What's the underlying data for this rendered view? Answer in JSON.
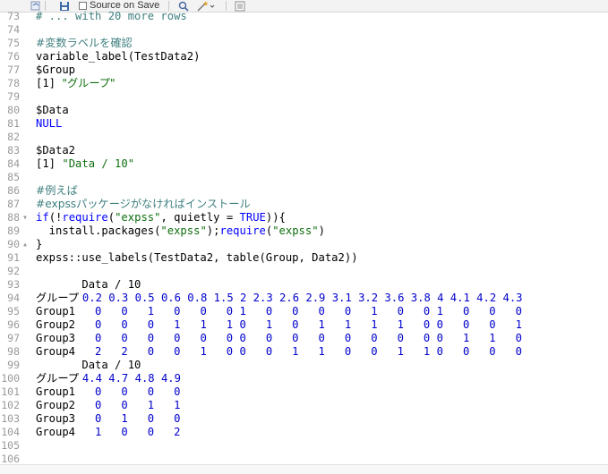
{
  "toolbar": {
    "source_on_save_label": "Source on Save"
  },
  "editor_lines": [
    {
      "n": "73",
      "fold": "",
      "segments": [
        {
          "t": "# ... with 20 more rows",
          "c": "c-comment"
        }
      ]
    },
    {
      "n": "74",
      "fold": "",
      "segments": []
    },
    {
      "n": "75",
      "fold": "",
      "segments": [
        {
          "t": "#変数ラベルを確認",
          "c": "c-comment c-jp"
        }
      ]
    },
    {
      "n": "76",
      "fold": "",
      "segments": [
        {
          "t": "variable_label(TestData2)",
          "c": "c-plain"
        }
      ]
    },
    {
      "n": "77",
      "fold": "",
      "segments": [
        {
          "t": "$Group",
          "c": "c-plain"
        }
      ]
    },
    {
      "n": "78",
      "fold": "",
      "segments": [
        {
          "t": "[1] ",
          "c": "c-plain"
        },
        {
          "t": "\"グループ\"",
          "c": "c-string c-jp"
        }
      ]
    },
    {
      "n": "79",
      "fold": "",
      "segments": []
    },
    {
      "n": "80",
      "fold": "",
      "segments": [
        {
          "t": "$Data",
          "c": "c-plain"
        }
      ]
    },
    {
      "n": "81",
      "fold": "",
      "segments": [
        {
          "t": "NULL",
          "c": "c-kw"
        }
      ]
    },
    {
      "n": "82",
      "fold": "",
      "segments": []
    },
    {
      "n": "83",
      "fold": "",
      "segments": [
        {
          "t": "$Data2",
          "c": "c-plain"
        }
      ]
    },
    {
      "n": "84",
      "fold": "",
      "segments": [
        {
          "t": "[1] ",
          "c": "c-plain"
        },
        {
          "t": "\"Data / 10\"",
          "c": "c-string"
        }
      ]
    },
    {
      "n": "85",
      "fold": "",
      "segments": []
    },
    {
      "n": "86",
      "fold": "",
      "segments": [
        {
          "t": "#例えば",
          "c": "c-comment c-jp"
        }
      ]
    },
    {
      "n": "87",
      "fold": "",
      "segments": [
        {
          "t": "#expssパッケージがなければインストール",
          "c": "c-comment c-jp"
        }
      ]
    },
    {
      "n": "88",
      "fold": "▾",
      "segments": [
        {
          "t": "if",
          "c": "c-kw"
        },
        {
          "t": "(!",
          "c": "c-plain"
        },
        {
          "t": "require",
          "c": "c-kw"
        },
        {
          "t": "(",
          "c": "c-plain"
        },
        {
          "t": "\"expss\"",
          "c": "c-string"
        },
        {
          "t": ", quietly = ",
          "c": "c-plain"
        },
        {
          "t": "TRUE",
          "c": "c-kw"
        },
        {
          "t": ")){",
          "c": "c-plain"
        }
      ]
    },
    {
      "n": "89",
      "fold": "",
      "segments": [
        {
          "t": "  install.packages(",
          "c": "c-plain"
        },
        {
          "t": "\"expss\"",
          "c": "c-string"
        },
        {
          "t": ");",
          "c": "c-plain"
        },
        {
          "t": "require",
          "c": "c-kw"
        },
        {
          "t": "(",
          "c": "c-plain"
        },
        {
          "t": "\"expss\"",
          "c": "c-string"
        },
        {
          "t": ")",
          "c": "c-plain"
        }
      ]
    },
    {
      "n": "90",
      "fold": "▴",
      "segments": [
        {
          "t": "}",
          "c": "c-plain"
        }
      ]
    },
    {
      "n": "91",
      "fold": "",
      "segments": [
        {
          "t": "expss::use_labels(TestData2, table(Group, Data2))",
          "c": "c-plain"
        }
      ]
    },
    {
      "n": "92",
      "fold": "",
      "segments": []
    },
    {
      "n": "93",
      "fold": "",
      "segments": [
        {
          "t": "       Data / 10",
          "c": "c-plain"
        }
      ]
    },
    {
      "n": "94",
      "fold": "",
      "segments": [
        {
          "t": "グループ ",
          "c": "c-plain c-jp"
        },
        {
          "t": "0.2 0.3 0.5 0.6 0.8 1.5 2 2.3 2.6 2.9 3.1 3.2 3.6 3.8 4 4.1 4.2 4.3",
          "c": "blue"
        }
      ]
    },
    {
      "n": "95",
      "fold": "",
      "segments": [
        {
          "t": "Group1   ",
          "c": "c-plain"
        },
        {
          "t": "0   0   1   0   0   0 1   0   0   0   0   1   0   0 1   0   0   0",
          "c": "blue"
        }
      ]
    },
    {
      "n": "96",
      "fold": "",
      "segments": [
        {
          "t": "Group2   ",
          "c": "c-plain"
        },
        {
          "t": "0   0   0   1   1   1 0   1   0   1   1   1   1   0 0   0   0   1",
          "c": "blue"
        }
      ]
    },
    {
      "n": "97",
      "fold": "",
      "segments": [
        {
          "t": "Group3   ",
          "c": "c-plain"
        },
        {
          "t": "0   0   0   0   0   0 0   0   0   0   0   0   0   0 0   1   1   0",
          "c": "blue"
        }
      ]
    },
    {
      "n": "98",
      "fold": "",
      "segments": [
        {
          "t": "Group4   ",
          "c": "c-plain"
        },
        {
          "t": "2   2   0   0   1   0 0   0   1   1   0   0   1   1 0   0   0   0",
          "c": "blue"
        }
      ]
    },
    {
      "n": "99",
      "fold": "",
      "segments": [
        {
          "t": "       Data / 10",
          "c": "c-plain"
        }
      ]
    },
    {
      "n": "100",
      "fold": "",
      "segments": [
        {
          "t": "グループ ",
          "c": "c-plain c-jp"
        },
        {
          "t": "4.4 4.7 4.8 4.9",
          "c": "blue"
        }
      ]
    },
    {
      "n": "101",
      "fold": "",
      "segments": [
        {
          "t": "Group1   ",
          "c": "c-plain"
        },
        {
          "t": "0   0   0   0",
          "c": "blue"
        }
      ]
    },
    {
      "n": "102",
      "fold": "",
      "segments": [
        {
          "t": "Group2   ",
          "c": "c-plain"
        },
        {
          "t": "0   0   1   1",
          "c": "blue"
        }
      ]
    },
    {
      "n": "103",
      "fold": "",
      "segments": [
        {
          "t": "Group3   ",
          "c": "c-plain"
        },
        {
          "t": "0   1   0   0",
          "c": "blue"
        }
      ]
    },
    {
      "n": "104",
      "fold": "",
      "segments": [
        {
          "t": "Group4   ",
          "c": "c-plain"
        },
        {
          "t": "1   0   0   2",
          "c": "blue"
        }
      ]
    },
    {
      "n": "105",
      "fold": "",
      "segments": []
    },
    {
      "n": "106",
      "fold": "",
      "segments": []
    }
  ],
  "icons": {
    "source": "source-icon",
    "save": "save-icon",
    "search": "search-icon",
    "wand": "code-tools-icon",
    "outline": "document-outline-icon"
  }
}
